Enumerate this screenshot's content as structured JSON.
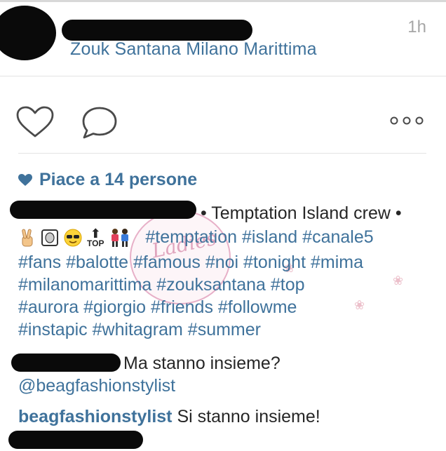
{
  "post": {
    "location": "Zouk Santana Milano Marittima",
    "time": "1h",
    "likes": "Piace a 14 persone",
    "caption": {
      "text": "• Temptation Island crew •",
      "line2_tags": "#temptation #island #canale5",
      "line3": "#fans #balotte #famous #noi #tonight #mima",
      "line4": "#milanomarittima #zouksantana #top",
      "line5": "#aurora #giorgio #friends #followme",
      "line6": "#instapic #whitagram #summer",
      "emoji_top_label": "TOP"
    },
    "comments": [
      {
        "text": "Ma stanno insieme?",
        "mention": "@beagfashionstylist"
      },
      {
        "username": "beagfashionstylist",
        "text": "Si stanno insieme!"
      }
    ]
  },
  "colors": {
    "link": "#3f729b",
    "text": "#262626",
    "muted": "#a6a6a6"
  },
  "icons": [
    "heart-outline-icon",
    "comment-bubble-icon",
    "more-options-icon",
    "heart-filled-icon"
  ]
}
